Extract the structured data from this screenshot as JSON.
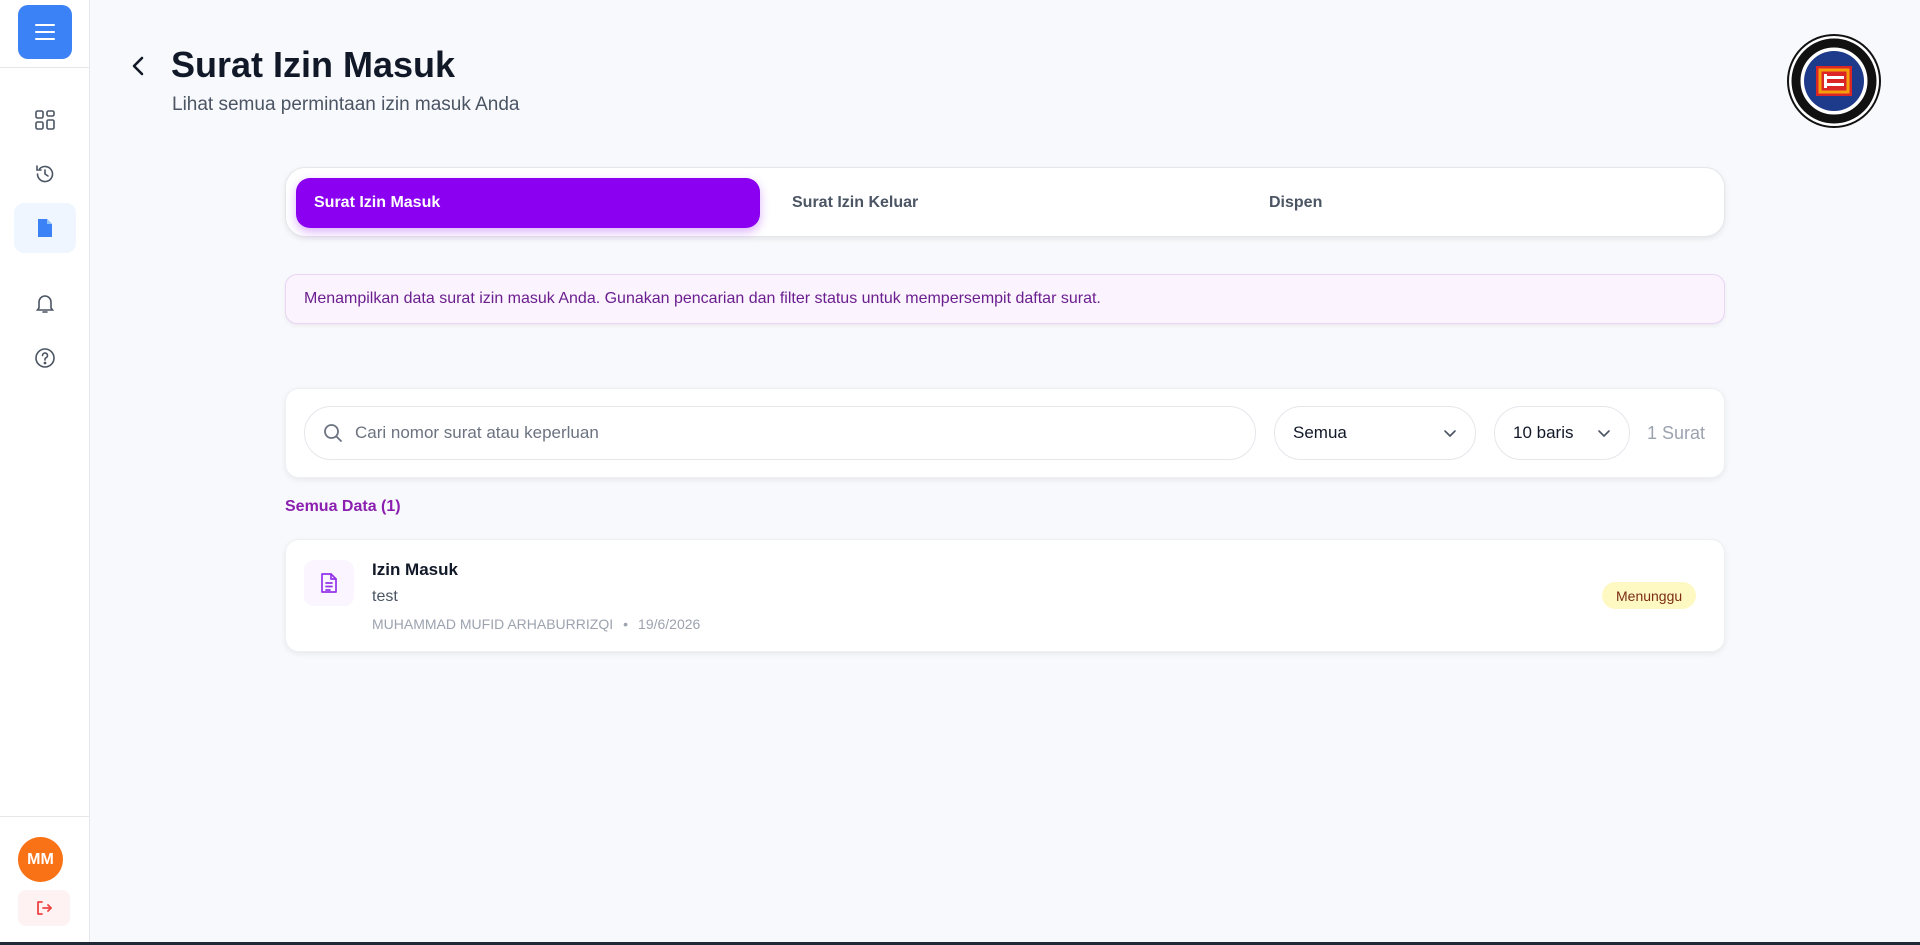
{
  "header": {
    "title": "Surat Izin Masuk",
    "subtitle": "Lihat semua permintaan izin masuk Anda"
  },
  "sidebar": {
    "items": [
      {
        "icon": "dashboard-icon"
      },
      {
        "icon": "history-icon"
      },
      {
        "icon": "document-icon",
        "active": true
      },
      {
        "icon": "bell-icon"
      },
      {
        "icon": "help-icon"
      }
    ],
    "avatar_initials": "MM"
  },
  "tabs": [
    {
      "label": "Surat Izin Masuk",
      "active": true
    },
    {
      "label": "Surat Izin Keluar",
      "active": false
    },
    {
      "label": "Dispen",
      "active": false
    }
  ],
  "info_text": "Menampilkan data surat izin masuk Anda. Gunakan pencarian dan filter status untuk mempersempit daftar surat.",
  "filters": {
    "search_placeholder": "Cari nomor surat atau keperluan",
    "status_value": "Semua",
    "rows_value": "10 baris",
    "count_text": "1 Surat"
  },
  "section_label": "Semua Data (1)",
  "items": [
    {
      "title": "Izin Masuk",
      "description": "test",
      "name": "MUHAMMAD MUFID ARHABURRIZQI",
      "date": "19/6/2026",
      "status": "Menunggu"
    }
  ],
  "colors": {
    "primary": "#8b00f0",
    "menu_button": "#3b82f6",
    "avatar": "#f97316",
    "status_badge": "#fef9c3"
  }
}
